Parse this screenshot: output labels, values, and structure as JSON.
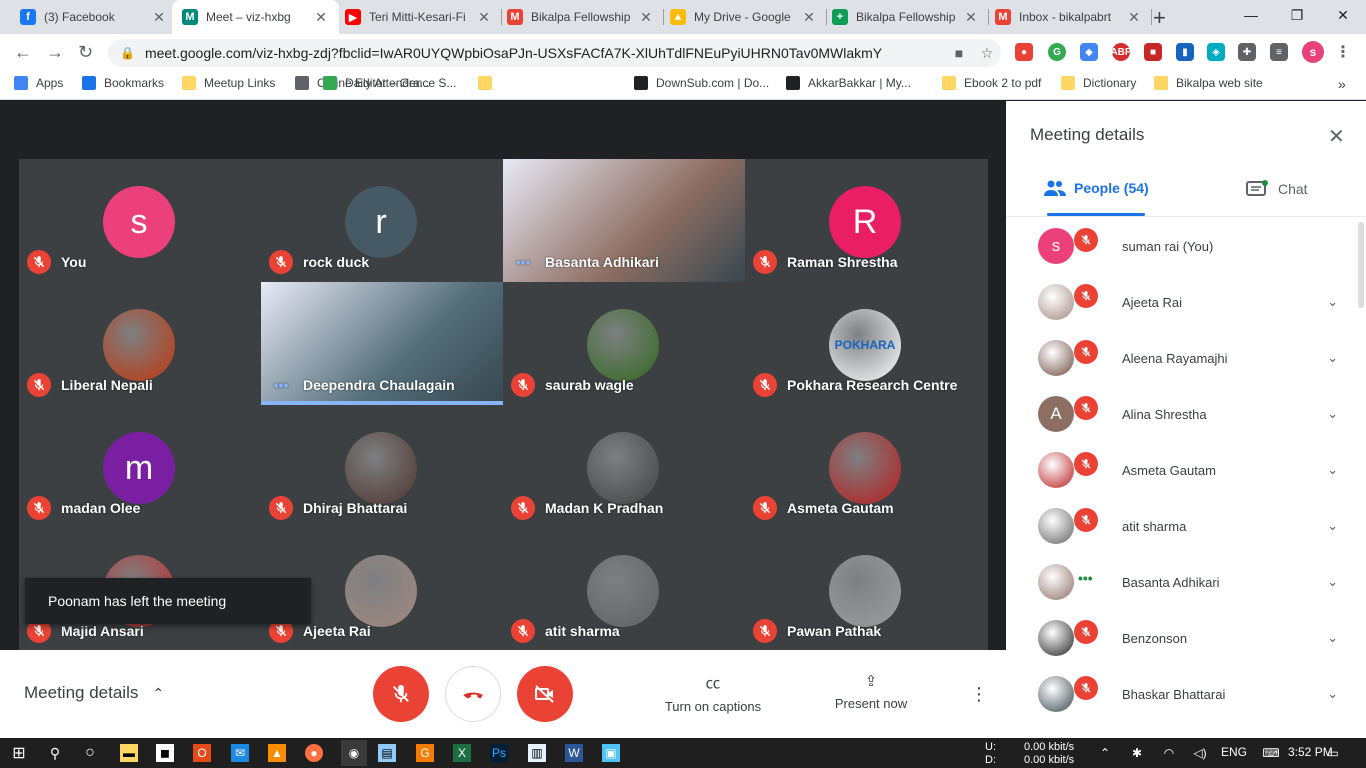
{
  "browser": {
    "tabs": [
      {
        "title": "(3) Facebook",
        "icon": "facebook-icon",
        "color": "#1877f2",
        "glyph": "f"
      },
      {
        "title": "Meet – viz-hxbg",
        "icon": "meet-icon",
        "color": "#00897b",
        "glyph": "M",
        "active": true
      },
      {
        "title": "Teri Mitti-Kesari-Fi",
        "icon": "youtube-icon",
        "color": "#ff0000",
        "glyph": "▶"
      },
      {
        "title": "Bikalpa Fellowship",
        "icon": "gmail-icon",
        "color": "#ea4335",
        "glyph": "M"
      },
      {
        "title": "My Drive - Google",
        "icon": "drive-icon",
        "color": "#fbbc04",
        "glyph": "▲"
      },
      {
        "title": "Bikalpa Fellowship",
        "icon": "sheets-icon",
        "color": "#0f9d58",
        "glyph": "+"
      },
      {
        "title": "Inbox - bikalpabrt",
        "icon": "gmail-icon",
        "color": "#ea4335",
        "glyph": "M"
      }
    ],
    "url": "meet.google.com/viz-hxbg-zdj?fbclid=IwAR0UYQWpbiOsaPJn-USXsFACfA7K-XlUhTdlFNEuPyiUHRN0Tav0MWlakmY",
    "profile_initial": "s",
    "bookmarks": [
      {
        "label": "Apps",
        "icon": "apps-icon",
        "color": "#4285f4"
      },
      {
        "label": "Bookmarks",
        "icon": "star-icon",
        "color": "#1a73e8"
      },
      {
        "label": "Meetup Links",
        "icon": "folder-icon",
        "color": "#fdd663"
      },
      {
        "label": "Online Editor – Gra...",
        "icon": "globe-icon",
        "color": "#5f6368"
      },
      {
        "label": "Daily Attendence S...",
        "icon": "check-icon",
        "color": "#34a853"
      },
      {
        "label": "",
        "icon": "folder-icon",
        "color": "#fdd663"
      },
      {
        "label": "DownSub.com | Do...",
        "icon": "downsub-icon",
        "color": "#202124"
      },
      {
        "label": "AkkarBakkar | My...",
        "icon": "akkar-icon",
        "color": "#202124"
      },
      {
        "label": "Ebook 2 to pdf",
        "icon": "folder-icon",
        "color": "#fdd663"
      },
      {
        "label": "Dictionary",
        "icon": "folder-icon",
        "color": "#fdd663"
      },
      {
        "label": "Bikalpa web site",
        "icon": "folder-icon",
        "color": "#fdd663"
      }
    ]
  },
  "tiles": [
    {
      "name": "You",
      "initial": "s",
      "color": "#ec407a"
    },
    {
      "name": "rock duck",
      "initial": "r",
      "color": "#455a64"
    },
    {
      "name": "Basanta Adhikari",
      "video": true,
      "speaking": true,
      "color": "#8d6e63"
    },
    {
      "name": "Raman Shrestha",
      "initial": "R",
      "color": "#e91e63"
    },
    {
      "name": "Liberal Nepali",
      "photo": "#bf360c"
    },
    {
      "name": "Deependra Chaulagain",
      "video": true,
      "speaking": true,
      "color": "#546e7a"
    },
    {
      "name": "saurab wagle",
      "photo": "#33691e"
    },
    {
      "name": "Pokhara Research Centre",
      "photo": "#ffffff",
      "logo": "POKHARA"
    },
    {
      "name": "madan Olee",
      "initial": "m",
      "color": "#7b1fa2"
    },
    {
      "name": "Dhiraj Bhattarai",
      "photo": "#4e342e"
    },
    {
      "name": "Madan K Pradhan",
      "photo": "#424242"
    },
    {
      "name": "Asmeta Gautam",
      "photo": "#b71c1c"
    },
    {
      "name": "Majid Ansari",
      "photo": "#c62828"
    },
    {
      "name": "Ajeeta Rai",
      "photo": "#a1887f"
    },
    {
      "name": "atit sharma",
      "photo": "#616161"
    },
    {
      "name": "Pawan Pathak",
      "photo": "#9e9e9e"
    }
  ],
  "toast": "Poonam has left the meeting",
  "controls": {
    "meeting_details": "Meeting details",
    "captions": "Turn on captions",
    "present": "Present now"
  },
  "panel": {
    "title": "Meeting details",
    "people_tab": "People (54)",
    "chat_tab": "Chat",
    "people": [
      {
        "name": "suman rai (You)",
        "initial": "s",
        "color": "#ec407a"
      },
      {
        "name": "Ajeeta Rai",
        "photo": "#a1887f"
      },
      {
        "name": "Aleena Rayamajhi",
        "photo": "#6d4c41"
      },
      {
        "name": "Alina Shrestha",
        "initial": "A",
        "color": "#8d6e63"
      },
      {
        "name": "Asmeta Gautam",
        "photo": "#b71c1c"
      },
      {
        "name": "atit sharma",
        "photo": "#616161"
      },
      {
        "name": "Basanta Adhikari",
        "photo": "#8d6e63",
        "speaking": true
      },
      {
        "name": "Benzonson",
        "photo": "#212121"
      },
      {
        "name": "Bhaskar Bhattarai",
        "photo": "#37474f"
      }
    ]
  },
  "taskbar": {
    "upload": "0.00 kbit/s",
    "download": "0.00 kbit/s",
    "up_label": "U:",
    "down_label": "D:",
    "lang": "ENG",
    "time": "3:52 PM"
  }
}
